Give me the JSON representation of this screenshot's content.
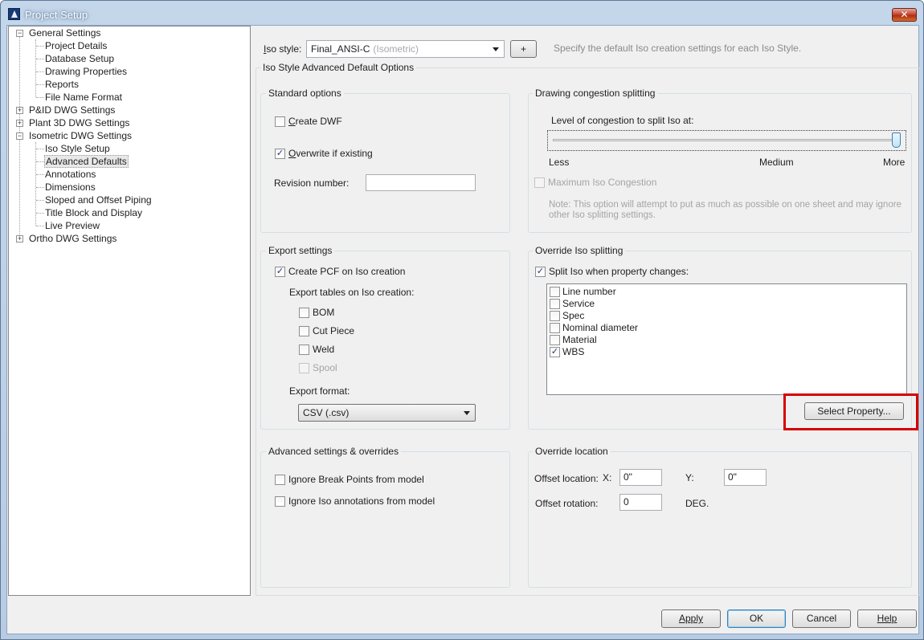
{
  "window": {
    "title": "Project Setup",
    "close_glyph": "✕"
  },
  "tree": {
    "items": [
      {
        "label": "General Settings",
        "expander": "−"
      },
      {
        "label": "Project Details"
      },
      {
        "label": "Database Setup"
      },
      {
        "label": "Drawing Properties"
      },
      {
        "label": "Reports"
      },
      {
        "label": "File Name Format"
      },
      {
        "label": "P&ID DWG Settings",
        "expander": "+"
      },
      {
        "label": "Plant 3D DWG Settings",
        "expander": "+"
      },
      {
        "label": "Isometric DWG Settings",
        "expander": "−"
      },
      {
        "label": "Iso Style Setup"
      },
      {
        "label": "Advanced Defaults",
        "selected": true
      },
      {
        "label": "Annotations"
      },
      {
        "label": "Dimensions"
      },
      {
        "label": "Sloped and Offset Piping"
      },
      {
        "label": "Title Block and Display"
      },
      {
        "label": "Live Preview"
      },
      {
        "label": "Ortho DWG Settings",
        "expander": "+"
      }
    ]
  },
  "iso_style": {
    "label_prefix": "I",
    "label_rest": "so style:",
    "value": "Final_ANSI-C",
    "value_muted": "(Isometric)",
    "add_button": "+",
    "hint": "Specify the default Iso creation settings for each Iso Style."
  },
  "advanced_group_title": "Iso Style Advanced Default Options",
  "standard_options": {
    "title": "Standard options",
    "create_dwf": {
      "mnemonic": "C",
      "rest": "reate DWF",
      "checked": false
    },
    "overwrite": {
      "mnemonic": "O",
      "rest": "verwrite if existing",
      "checked": true
    },
    "revision_label": "Revision number:",
    "revision_value": ""
  },
  "congestion": {
    "title": "Drawing congestion splitting",
    "level_label": "Level of congestion to split Iso at:",
    "level_value": 1.0,
    "tick_less": "Less",
    "tick_medium": "Medium",
    "tick_more": "More",
    "max_label": "Maximum Iso Congestion",
    "max_checked": false,
    "note": "Note: This option will attempt to put as much as possible on one sheet and may ignore other Iso splitting settings."
  },
  "export": {
    "title": "Export settings",
    "create_pcf": {
      "label": "Create PCF on Iso creation",
      "checked": true
    },
    "tables_label": "Export tables on Iso creation:",
    "tables": [
      {
        "label": "BOM",
        "checked": false,
        "disabled": false
      },
      {
        "label": "Cut Piece",
        "checked": false,
        "disabled": false
      },
      {
        "label": "Weld",
        "checked": false,
        "disabled": false
      },
      {
        "label": "Spool",
        "checked": false,
        "disabled": true
      }
    ],
    "format_label": "Export format:",
    "format_value": "CSV (.csv)"
  },
  "override_split": {
    "title": "Override Iso splitting",
    "split_label": "Split Iso when property changes:",
    "split_checked": true,
    "properties": [
      {
        "label": "Line number",
        "checked": false
      },
      {
        "label": "Service",
        "checked": false
      },
      {
        "label": "Spec",
        "checked": false
      },
      {
        "label": "Nominal diameter",
        "checked": false
      },
      {
        "label": "Material",
        "checked": false
      },
      {
        "label": "WBS",
        "checked": true
      }
    ],
    "select_button": "Select Property..."
  },
  "advanced_overrides": {
    "title": "Advanced settings & overrides",
    "ignore_break": {
      "label": "Ignore Break Points from model",
      "checked": false
    },
    "ignore_annot": {
      "label": "Ignore Iso annotations from model",
      "checked": false
    }
  },
  "override_location": {
    "title": "Override location",
    "offset_label": "Offset location:",
    "x_label": "X:",
    "x_value": "0\"",
    "y_label": "Y:",
    "y_value": "0\"",
    "rotation_label": "Offset rotation:",
    "rotation_value": "0",
    "deg_label": "DEG."
  },
  "buttons": {
    "apply": "Apply",
    "ok": "OK",
    "cancel": "Cancel",
    "help": "Help"
  },
  "colors": {
    "highlight": "#d60000",
    "selection": "#e8e8e8"
  },
  "check_glyph": "✓"
}
